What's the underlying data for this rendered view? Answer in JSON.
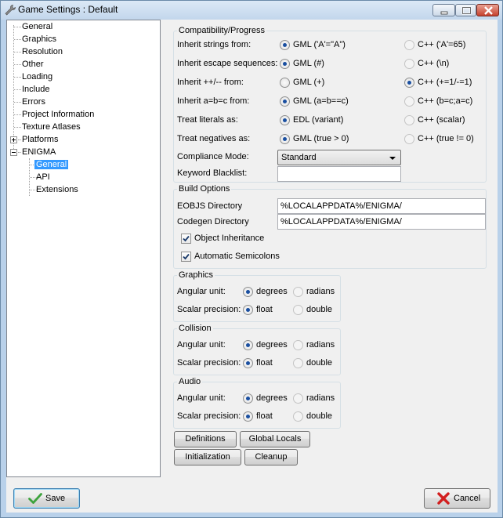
{
  "window": {
    "title": "Game Settings : Default"
  },
  "tree": {
    "items": [
      {
        "label": "General"
      },
      {
        "label": "Graphics"
      },
      {
        "label": "Resolution"
      },
      {
        "label": "Other"
      },
      {
        "label": "Loading"
      },
      {
        "label": "Include"
      },
      {
        "label": "Errors"
      },
      {
        "label": "Project Information"
      },
      {
        "label": "Texture Atlases"
      },
      {
        "label": "Platforms"
      },
      {
        "label": "ENIGMA"
      },
      {
        "label": "General"
      },
      {
        "label": "API"
      },
      {
        "label": "Extensions"
      }
    ],
    "selected": "General"
  },
  "compat": {
    "legend": "Compatibility/Progress",
    "rows": [
      {
        "label": "Inherit strings from:",
        "a": "GML ('A'=\"A\")",
        "b": "C++ ('A'=65)",
        "selected": "a",
        "b_enabled": false
      },
      {
        "label": "Inherit escape sequences:",
        "a": "GML (#)",
        "b": "C++ (\\n)",
        "selected": "a",
        "b_enabled": false
      },
      {
        "label": "Inherit ++/-- from:",
        "a": "GML (+)",
        "b": "C++ (+=1/-=1)",
        "selected": "b",
        "b_enabled": true
      },
      {
        "label": "Inherit a=b=c from:",
        "a": "GML (a=b==c)",
        "b": "C++ (b=c;a=c)",
        "selected": "a",
        "b_enabled": false
      },
      {
        "label": "Treat literals as:",
        "a": "EDL (variant)",
        "b": "C++ (scalar)",
        "selected": "a",
        "b_enabled": false
      },
      {
        "label": "Treat negatives as:",
        "a": "GML (true > 0)",
        "b": "C++ (true != 0)",
        "selected": "a",
        "b_enabled": false
      }
    ],
    "compliance_label": "Compliance Mode:",
    "compliance_value": "Standard",
    "blacklist_label": "Keyword Blacklist:",
    "blacklist_value": ""
  },
  "build": {
    "legend": "Build Options",
    "eobjs_label": "EOBJS Directory",
    "eobjs_value": "%LOCALAPPDATA%/ENIGMA/",
    "codegen_label": "Codegen Directory",
    "codegen_value": "%LOCALAPPDATA%/ENIGMA/",
    "object_inheritance_label": "Object Inheritance",
    "object_inheritance_checked": true,
    "auto_semicolons_label": "Automatic Semicolons",
    "auto_semicolons_checked": true
  },
  "extension_groups": [
    {
      "legend": "Graphics",
      "angular_label": "Angular unit:",
      "angular_a": "degrees",
      "angular_b": "radians",
      "scalar_label": "Scalar precision:",
      "scalar_a": "float",
      "scalar_b": "double"
    },
    {
      "legend": "Collision",
      "angular_label": "Angular unit:",
      "angular_a": "degrees",
      "angular_b": "radians",
      "scalar_label": "Scalar precision:",
      "scalar_a": "float",
      "scalar_b": "double"
    },
    {
      "legend": "Audio",
      "angular_label": "Angular unit:",
      "angular_a": "degrees",
      "angular_b": "radians",
      "scalar_label": "Scalar precision:",
      "scalar_a": "float",
      "scalar_b": "double"
    }
  ],
  "buttons": {
    "definitions": "Definitions",
    "global_locals": "Global Locals",
    "initialization": "Initialization",
    "cleanup": "Cleanup",
    "save": "Save",
    "cancel": "Cancel"
  },
  "icons": {
    "title": "wrench-icon",
    "save": "checkmark-icon",
    "cancel": "red-x-icon"
  },
  "colors": {
    "selection": "#3399ff",
    "save_check": "#3da33d",
    "cancel_x": "#d21f1f"
  }
}
